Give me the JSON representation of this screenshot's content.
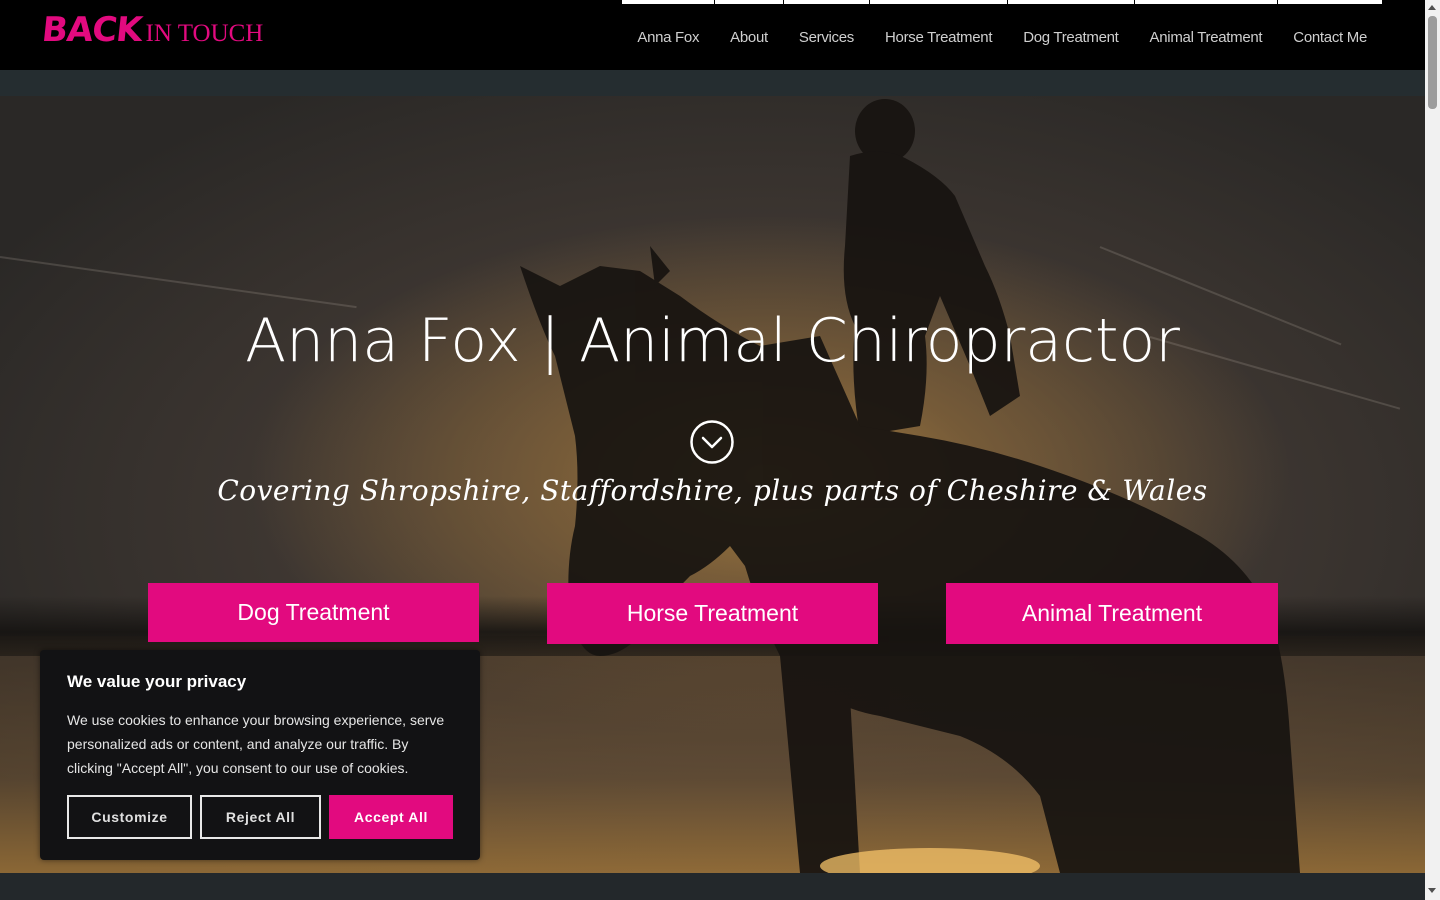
{
  "header": {
    "logo": {
      "bold_text": "BACK",
      "text": "IN TOUCH"
    },
    "nav": [
      {
        "label": "Anna Fox"
      },
      {
        "label": "About"
      },
      {
        "label": "Services"
      },
      {
        "label": "Horse Treatment"
      },
      {
        "label": "Dog Treatment"
      },
      {
        "label": "Animal Treatment"
      },
      {
        "label": "Contact Me"
      }
    ]
  },
  "hero": {
    "title": "Anna Fox | Animal Chiropractor",
    "scroll_icon": "chevron-down-circle-icon",
    "subtitle": "Covering Shropshire, Staffordshire, plus parts of Cheshire & Wales",
    "buttons": {
      "dog": "Dog Treatment",
      "horse": "Horse Treatment",
      "animal": "Animal Treatment"
    }
  },
  "cookie_banner": {
    "title": "We value your privacy",
    "text": "We use cookies to enhance your browsing experience, serve personalized ads or content, and analyze our traffic. By clicking \"Accept All\", you consent to our use of cookies.",
    "customize": "Customize",
    "reject": "Reject All",
    "accept": "Accept All"
  },
  "colors": {
    "accent": "#e20a7f",
    "header_bg": "#000000",
    "banner_bg": "#121214"
  }
}
